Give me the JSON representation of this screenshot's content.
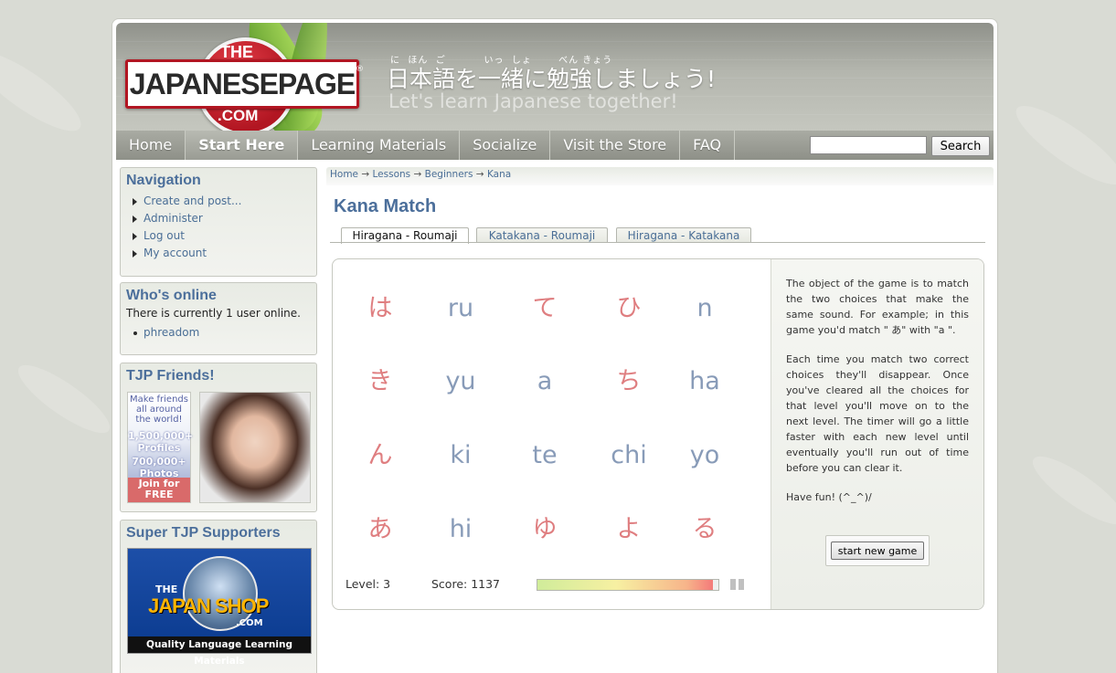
{
  "site": {
    "logo_the": "THE",
    "logo_main": "JAPANESEPAGE",
    "logo_com": ".COM",
    "logo_reg": "®",
    "furigana": "に  ほん  ご          いっ  しょ       べん きょう",
    "slogan_jp": "日本語を一緒に勉強しましょう!",
    "slogan_en": "Let's learn Japanese together!"
  },
  "nav": {
    "items": [
      "Home",
      "Start Here",
      "Learning Materials",
      "Socialize",
      "Visit the Store",
      "FAQ"
    ],
    "active": "Start Here",
    "search_placeholder": "",
    "search_button": "Search"
  },
  "sidebar": {
    "navigation": {
      "title": "Navigation",
      "items": [
        "Create and post...",
        "Administer",
        "Log out",
        "My account"
      ]
    },
    "whos_online": {
      "title": "Who's online",
      "text": "There is currently 1 user online.",
      "users": [
        "phreadom"
      ]
    },
    "friends": {
      "title": "TJP Friends!",
      "ad_line1": "Make friends all around the world!",
      "ad_line2": "1,500,000+ Profiles",
      "ad_line3": "700,000+ Photos",
      "ad_join": "Join for FREE"
    },
    "supporters": {
      "title": "Super TJP Supporters",
      "shop_the": "THE",
      "shop_name": "JAPAN SHOP",
      "shop_reg": "®",
      "shop_com": ".COM",
      "shop_tagline": "Quality Language Learning Materials"
    }
  },
  "breadcrumb": [
    "Home",
    "Lessons",
    "Beginners",
    "Kana"
  ],
  "breadcrumb_sep": "→",
  "page_title": "Kana Match",
  "tabs": [
    {
      "label": "Hiragana - Roumaji",
      "active": true
    },
    {
      "label": "Katakana - Roumaji",
      "active": false
    },
    {
      "label": "Hiragana - Katakana",
      "active": false
    }
  ],
  "game": {
    "grid": [
      [
        {
          "t": "は",
          "k": "hira"
        },
        {
          "t": "ru",
          "k": "roma"
        },
        {
          "t": "て",
          "k": "hira"
        },
        {
          "t": "ひ",
          "k": "hira"
        },
        {
          "t": "n",
          "k": "roma"
        }
      ],
      [
        {
          "t": "き",
          "k": "hira"
        },
        {
          "t": "yu",
          "k": "roma"
        },
        {
          "t": "a",
          "k": "roma"
        },
        {
          "t": "ち",
          "k": "hira"
        },
        {
          "t": "ha",
          "k": "roma"
        }
      ],
      [
        {
          "t": "ん",
          "k": "hira"
        },
        {
          "t": "ki",
          "k": "roma"
        },
        {
          "t": "te",
          "k": "roma"
        },
        {
          "t": "chi",
          "k": "roma"
        },
        {
          "t": "yo",
          "k": "roma"
        }
      ],
      [
        {
          "t": "あ",
          "k": "hira"
        },
        {
          "t": "hi",
          "k": "roma"
        },
        {
          "t": "ゆ",
          "k": "hira"
        },
        {
          "t": "よ",
          "k": "hira"
        },
        {
          "t": "る",
          "k": "hira"
        }
      ]
    ],
    "colors": {
      "hira": "#df7e80",
      "roma": "#889bb8"
    },
    "level_label": "Level: 3",
    "score_label": "Score: 1137",
    "timer_fraction": 0.97,
    "info": [
      "The object of the game is to match the two choices that make the same sound. For example; in this game you'd match \" あ\" with \"a \".",
      "Each time you match two correct choices they'll disappear. Once you've cleared all the choices for that level you'll move on to the next level. The timer will go a little faster with each new level until eventually you'll run out of time before you can clear it.",
      "Have fun! (^_^)/"
    ],
    "new_game_button": "start new game"
  }
}
